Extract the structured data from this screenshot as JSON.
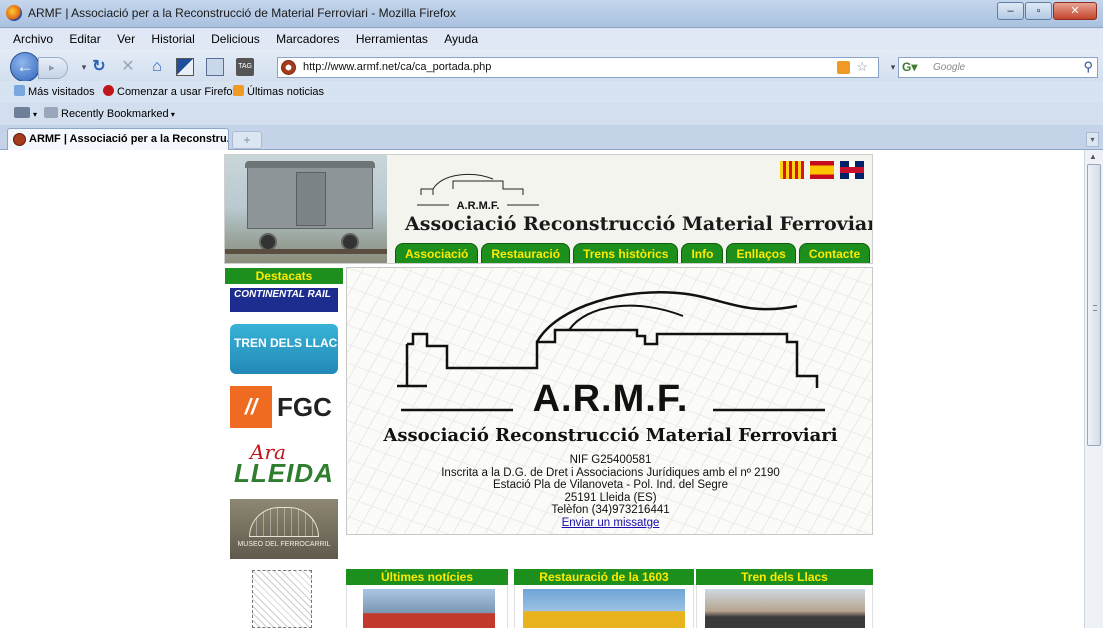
{
  "window": {
    "title": "ARMF | Associació per a la Reconstrucció de Material Ferroviari - Mozilla Firefox",
    "controls": {
      "minimize": "–",
      "maximize": "▫",
      "close": "✕"
    }
  },
  "menu": [
    "Archivo",
    "Editar",
    "Ver",
    "Historial",
    "Delicious",
    "Marcadores",
    "Herramientas",
    "Ayuda"
  ],
  "navigation": {
    "url": "http://www.armf.net/ca/ca_portada.php",
    "search_placeholder": "Google"
  },
  "bookmarks": {
    "row1": [
      "Más visitados",
      "Comenzar a usar Firefox",
      "Últimas noticias"
    ],
    "row2": [
      "Recently Bookmarked"
    ]
  },
  "tab": {
    "label": "ARMF | Associació per a la Reconstru...",
    "new_tab": "+"
  },
  "page": {
    "banner_title": "Associació Reconstrucció Material Ferroviari",
    "logo_small_text": "A.R.M.F.",
    "nav": [
      "Associació",
      "Restauració",
      "Trens històrics",
      "Info",
      "Enllaços",
      "Contacte"
    ],
    "languages": [
      "Català",
      "Español",
      "English"
    ],
    "sidebar": {
      "heading": "Destacats",
      "sponsors": {
        "continental": "CONTINENTAL RAIL",
        "trenllacs": "TREN DELS LLACS",
        "fgc": "FGC",
        "ara": "Ara",
        "lleida": "LLEIDA",
        "museo": "MUSEO DEL FERROCARRIL"
      }
    },
    "main": {
      "logo": "A.R.M.F.",
      "name": "Associació Reconstrucció Material Ferroviari",
      "nif": "NIF G25400581",
      "registry": "Inscrita a la D.G. de Dret i Associacions Jurídiques amb el nº 2190",
      "address": "Estació Pla de Vilanoveta - Pol. Ind. del Segre",
      "city": "25191 Lleida (ES)",
      "phone": "Telèfon (34)973216441",
      "message_link": "Enviar un missatge"
    },
    "sections": [
      "Últimes notícies",
      "Restauració de la 1603",
      "Tren dels Llacs"
    ]
  },
  "colors": {
    "accent_green": "#1d8f1d",
    "accent_yellow": "#ffea00",
    "link": "#1a0dab"
  }
}
